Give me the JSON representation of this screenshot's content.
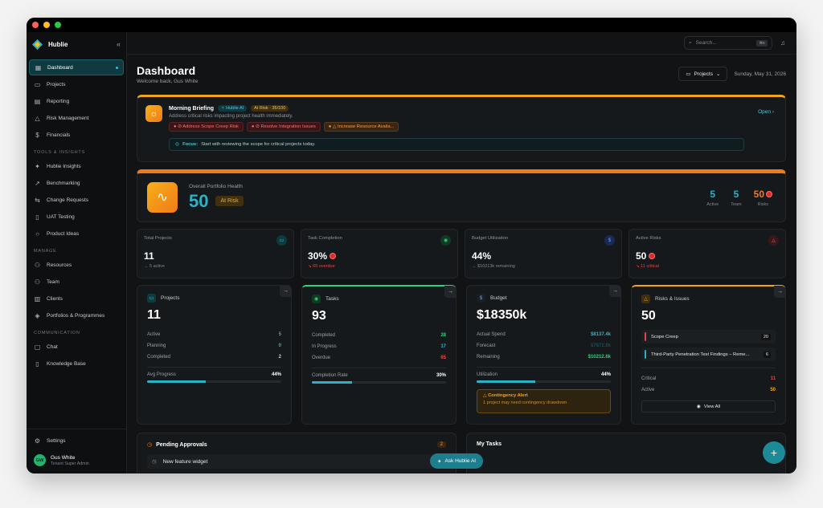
{
  "app": {
    "name": "Hublie"
  },
  "sidebar": {
    "main": [
      {
        "label": "Dashboard",
        "icon": "grid-icon"
      },
      {
        "label": "Projects",
        "icon": "folder-icon"
      },
      {
        "label": "Reporting",
        "icon": "report-icon"
      },
      {
        "label": "Risk Management",
        "icon": "warning-icon"
      },
      {
        "label": "Financials",
        "icon": "dollar-icon"
      }
    ],
    "tools_label": "TOOLS & INSIGHTS",
    "tools": [
      {
        "label": "Hublie Insights"
      },
      {
        "label": "Benchmarking"
      },
      {
        "label": "Change Requests"
      },
      {
        "label": "UAT Testing"
      },
      {
        "label": "Product Ideas"
      }
    ],
    "manage_label": "MANAGE",
    "manage": [
      {
        "label": "Resources"
      },
      {
        "label": "Team"
      },
      {
        "label": "Clients"
      },
      {
        "label": "Portfolios & Programmes"
      }
    ],
    "comm_label": "COMMUNICATION",
    "comm": [
      {
        "label": "Chat"
      },
      {
        "label": "Knowledge Base"
      }
    ],
    "settings": "Settings",
    "user": {
      "initials": "GW",
      "name": "Gus White",
      "role": "Tenant Super Admin"
    }
  },
  "topbar": {
    "search_placeholder": "Search...",
    "shortcut": "⌘K"
  },
  "header": {
    "title": "Dashboard",
    "welcome": "Welcome back, Gus White",
    "projects_button": "Projects",
    "date": "Sunday, May 31, 2026"
  },
  "briefing": {
    "title": "Morning Briefing",
    "ai_badge": "Hublie AI",
    "risk_badge": "At Risk · 35/100",
    "description": "Address critical risks impacting project health immediately.",
    "tags": [
      "Address Scope Creep Risk",
      "Resolve Integration Issues",
      "Increase Resource Availa..."
    ],
    "focus_label": "Focus:",
    "focus_text": "Start with reviewing the scope for critical projects today.",
    "open": "Open"
  },
  "health": {
    "label": "Overall Portfolio Health",
    "value": "50",
    "status": "At Risk",
    "stats": [
      {
        "value": "5",
        "label": "Active",
        "color": "#2bb2c9"
      },
      {
        "value": "5",
        "label": "Team",
        "color": "#2bb2c9"
      },
      {
        "value": "50",
        "label": "Risks",
        "color": "#f07a1a"
      }
    ]
  },
  "kpis": [
    {
      "label": "Total Projects",
      "value": "11",
      "sub": "→ 5 active"
    },
    {
      "label": "Task Completion",
      "value": "30%",
      "sub": "↘ 65 overdue"
    },
    {
      "label": "Budget Utilization",
      "value": "44%",
      "sub": "→ $10213k remaining"
    },
    {
      "label": "Active Risks",
      "value": "50",
      "sub": "↘ 11 critical"
    }
  ],
  "projects_card": {
    "title": "Projects",
    "value": "11",
    "rows": [
      {
        "label": "Active",
        "value": "5"
      },
      {
        "label": "Planning",
        "value": "0"
      },
      {
        "label": "Completed",
        "value": "2"
      }
    ],
    "progress_label": "Avg Progress",
    "progress_value": "44%",
    "progress": 44
  },
  "tasks_card": {
    "title": "Tasks",
    "value": "93",
    "rows": [
      {
        "label": "Completed",
        "value": "28"
      },
      {
        "label": "In Progress",
        "value": "17"
      },
      {
        "label": "Overdue",
        "value": "65"
      }
    ],
    "progress_label": "Completion Rate",
    "progress_value": "30%",
    "progress": 30
  },
  "budget_card": {
    "title": "Budget",
    "value": "$18350k",
    "rows": [
      {
        "label": "Actual Spend",
        "value": "$8137.4k"
      },
      {
        "label": "Forecast",
        "value": "$7872.8k"
      },
      {
        "label": "Remaining",
        "value": "$10212.6k"
      }
    ],
    "progress_label": "Utilization",
    "progress_value": "44%",
    "progress": 44,
    "alert_title": "Contingency Alert",
    "alert_text": "1 project may need contingency drawdown"
  },
  "risks_card": {
    "title": "Risks & Issues",
    "value": "50",
    "items": [
      {
        "label": "Scope Creep",
        "count": "20"
      },
      {
        "label": "Third-Party Penetration Test Findings – Reme...",
        "count": "6"
      }
    ],
    "rows": [
      {
        "label": "Critical",
        "value": "11"
      },
      {
        "label": "Active",
        "value": "50"
      }
    ],
    "view_all": "View All"
  },
  "approvals": {
    "title": "Pending Approvals",
    "count": "2",
    "first_item": "New feature widget"
  },
  "my_tasks": {
    "title": "My Tasks"
  },
  "ask_ai": "Ask Hublie AI",
  "colors": {
    "accent": "#2bb2c9",
    "warning": "#f0a51c",
    "danger": "#e04848",
    "success": "#2fd07a"
  }
}
